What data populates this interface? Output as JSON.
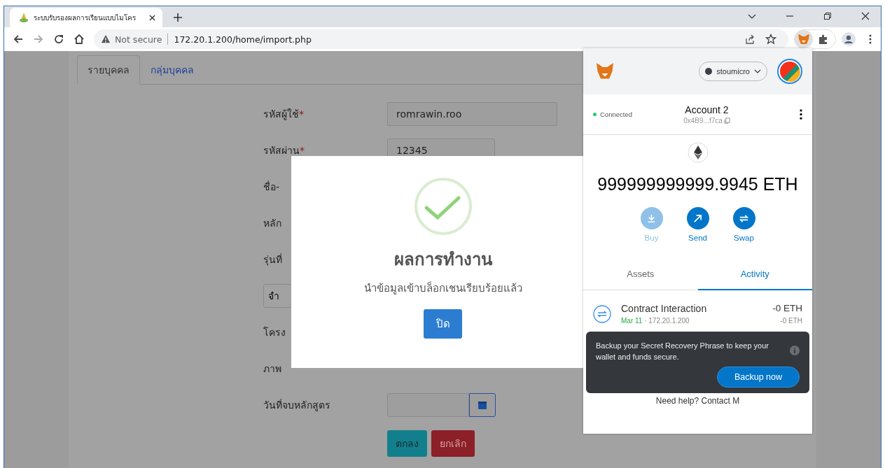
{
  "browser": {
    "tab_title": "ระบบรับรองผลการเรียนแบบไมโคร",
    "url_warning": "Not secure",
    "url": "172.20.1.200/home/import.php"
  },
  "page": {
    "tabs": [
      {
        "label": "รายบุคคล",
        "selected": true
      },
      {
        "label": "กลุ่มบุคคล",
        "selected": false
      }
    ],
    "fields": [
      {
        "kind": "input",
        "label": "รหัสผู้ใช้",
        "mark": "*",
        "value": "romrawin.roo"
      },
      {
        "kind": "input",
        "label": "รหัสผ่าน",
        "mark": "*",
        "value": "12345"
      },
      {
        "kind": "label",
        "label": "ชื่อ-"
      },
      {
        "kind": "label",
        "label": "หลัก"
      },
      {
        "kind": "label",
        "label": "รุ่นที่"
      },
      {
        "kind": "select",
        "value": "จำ"
      },
      {
        "kind": "label",
        "label": "โครง"
      },
      {
        "kind": "label",
        "label": "ภาพ"
      },
      {
        "kind": "date",
        "label": "วันที่จบหลักสูตร"
      }
    ],
    "buttons": [
      {
        "label": "ตกลง",
        "kind": "primary"
      },
      {
        "label": "ยกเลิก",
        "kind": "danger"
      }
    ]
  },
  "dialog": {
    "title": "ผลการทำงาน",
    "message": "นำข้อมูลเข้าบล็อกเชนเรียบร้อยแล้ว",
    "button": "ปิด"
  },
  "wallet": {
    "network": "stoumicro",
    "status": "Connected",
    "account": "Account 2",
    "address": "0x4B9...f7ca",
    "balance": "999999999999.9945 ETH",
    "actions": [
      {
        "label": "Buy",
        "kind": "buy",
        "disabled": true
      },
      {
        "label": "Send",
        "kind": "send",
        "disabled": false
      },
      {
        "label": "Swap",
        "kind": "swap",
        "disabled": false
      }
    ],
    "tabs": [
      {
        "label": "Assets",
        "selected": false
      },
      {
        "label": "Activity",
        "selected": true
      }
    ],
    "activity": [
      {
        "title": "Contract Interaction",
        "date": "Mar 11",
        "origin": "· 172.20.1.200",
        "amount": "-0 ETH",
        "sub_amount": "-0 ETH"
      }
    ],
    "help": "Need help? Contact M",
    "toast": {
      "message": "Backup your Secret Recovery Phrase to keep your wallet and funds secure.",
      "button": "Backup now"
    }
  }
}
